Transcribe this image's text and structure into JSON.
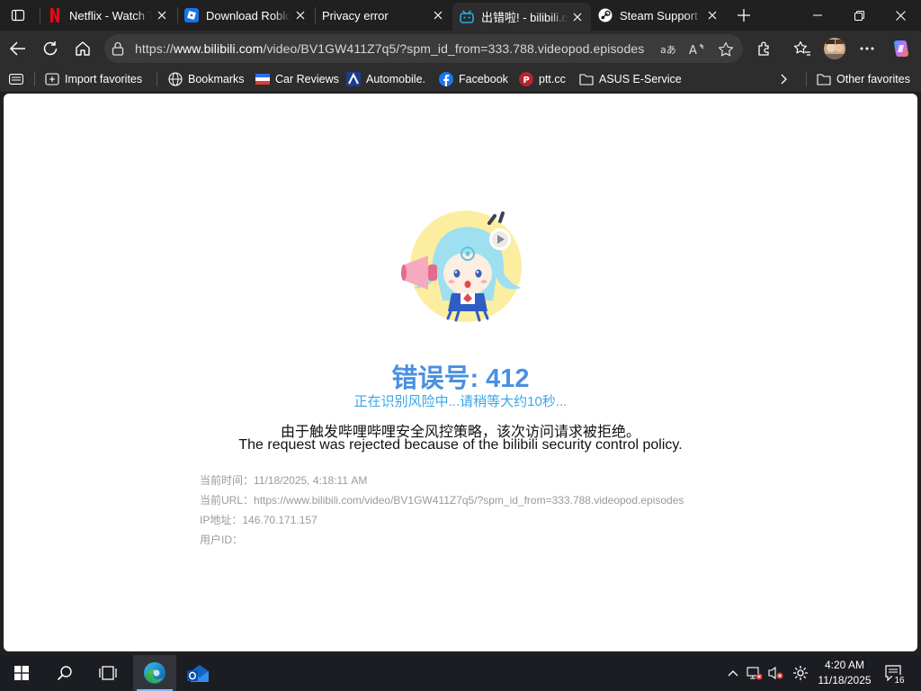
{
  "tabs": [
    {
      "title": "Netflix - Watch TV Shows Online",
      "icon": "netflix-icon"
    },
    {
      "title": "Download Roblox",
      "icon": "roblox-icon"
    },
    {
      "title": "Privacy error",
      "icon": ""
    },
    {
      "title": "出错啦! - bilibili.com",
      "icon": "bilibili-icon",
      "active": true
    },
    {
      "title": "Steam Support - Help",
      "icon": "steam-icon"
    }
  ],
  "address_bar": {
    "url_prefix": "https://",
    "url_host": "www.bilibili.com",
    "url_path": "/video/BV1GW411Z7q5/?spm_id_from=333.788.videopod.episodes"
  },
  "favorites": [
    {
      "label": "Import favorites",
      "icon": "import-icon"
    },
    {
      "label": "Bookmarks",
      "icon": "globe-icon"
    },
    {
      "label": "Car Reviews",
      "icon": "flag-icon"
    },
    {
      "label": "Automobile.",
      "icon": "automobile-icon"
    },
    {
      "label": "Facebook",
      "icon": "facebook-icon"
    },
    {
      "label": "ptt.cc",
      "icon": "ptt-icon"
    },
    {
      "label": "ASUS E-Service",
      "icon": "folder-icon"
    },
    {
      "label": "Other favorites",
      "icon": "folder-icon"
    }
  ],
  "error": {
    "code_line": "错误号: 412",
    "waiting": "正在识别风险中...请稍等大约10秒...",
    "message_cn": "由于触发哔哩哔哩安全风控策略，该次访问请求被拒绝。",
    "message_en": "The request was rejected because of the bilibili security control policy."
  },
  "meta": {
    "time_label": "当前时间：",
    "time_value": "11/18/2025, 4:18:11 AM",
    "url_label": "当前URL：",
    "url_value": "https://www.bilibili.com/video/BV1GW411Z7q5/?spm_id_from=333.788.videopod.episodes",
    "ip_label": "IP地址：",
    "ip_value": "146.70.171.157",
    "uid_label": "用户ID："
  },
  "taskbar": {
    "time": "4:20 AM",
    "date": "11/18/2025",
    "notifications": "16"
  },
  "colors": {
    "error_blue": "#4a90e2",
    "waiting_blue": "#3aa6e8",
    "chrome_dark": "#202020"
  }
}
